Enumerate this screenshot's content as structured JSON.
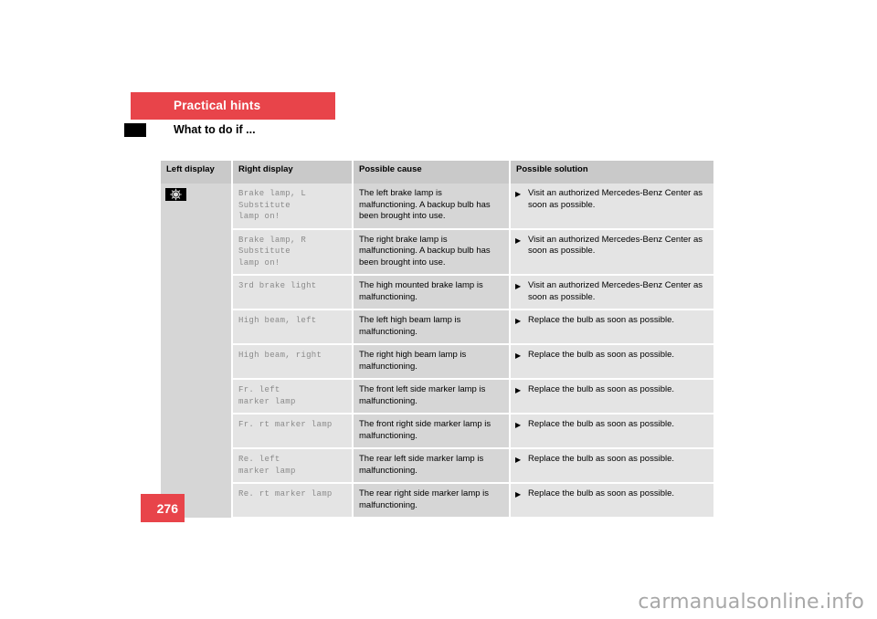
{
  "document": {
    "chapter_banner": "Practical hints",
    "section_title": "What to do if ...",
    "page_number": "276",
    "watermark": "carmanualsonline.info",
    "accent_color": "#e8444a",
    "marker_color": "#000000"
  },
  "table": {
    "headers": {
      "left_display": "Left display",
      "right_display": "Right display",
      "possible_cause": "Possible cause",
      "possible_solution": "Possible solution"
    },
    "bullet_glyph": "▶",
    "left_display_icon": "bulb-failure-warning-icon",
    "rows": [
      {
        "right_display": [
          "Brake lamp, L",
          "Substitute",
          "lamp on!"
        ],
        "cause": "The left brake lamp is malfunctioning. A backup bulb has been brought into use.",
        "solution": "Visit an authorized Mercedes-Benz Center as soon as possible."
      },
      {
        "right_display": [
          "Brake lamp, R",
          "Substitute",
          "lamp on!"
        ],
        "cause": "The right brake lamp is malfunctioning. A backup bulb has been brought into use.",
        "solution": "Visit an authorized Mercedes-Benz Center as soon as possible."
      },
      {
        "right_display": [
          "3rd brake light"
        ],
        "cause": "The high mounted brake lamp is malfunctioning.",
        "solution": "Visit an authorized Mercedes-Benz Center as soon as possible."
      },
      {
        "right_display": [
          "High beam, left"
        ],
        "cause": "The left high beam lamp is malfunctioning.",
        "solution": "Replace the bulb as soon as possible."
      },
      {
        "right_display": [
          "High beam, right"
        ],
        "cause": "The right high beam lamp is malfunctioning.",
        "solution": "Replace the bulb as soon as possible."
      },
      {
        "right_display": [
          "Fr. left",
          "marker lamp"
        ],
        "cause": "The front left side marker lamp is malfunctioning.",
        "solution": "Replace the bulb as soon as possible."
      },
      {
        "right_display": [
          "Fr. rt marker lamp"
        ],
        "cause": "The front right side marker lamp is malfunctioning.",
        "solution": "Replace the bulb as soon as possible."
      },
      {
        "right_display": [
          "Re. left",
          "marker lamp"
        ],
        "cause": "The rear left side marker lamp is malfunctioning.",
        "solution": "Replace the bulb as soon as possible."
      },
      {
        "right_display": [
          "Re. rt marker lamp"
        ],
        "cause": "The rear right side marker lamp is malfunctioning.",
        "solution": "Replace the bulb as soon as possible."
      }
    ]
  }
}
